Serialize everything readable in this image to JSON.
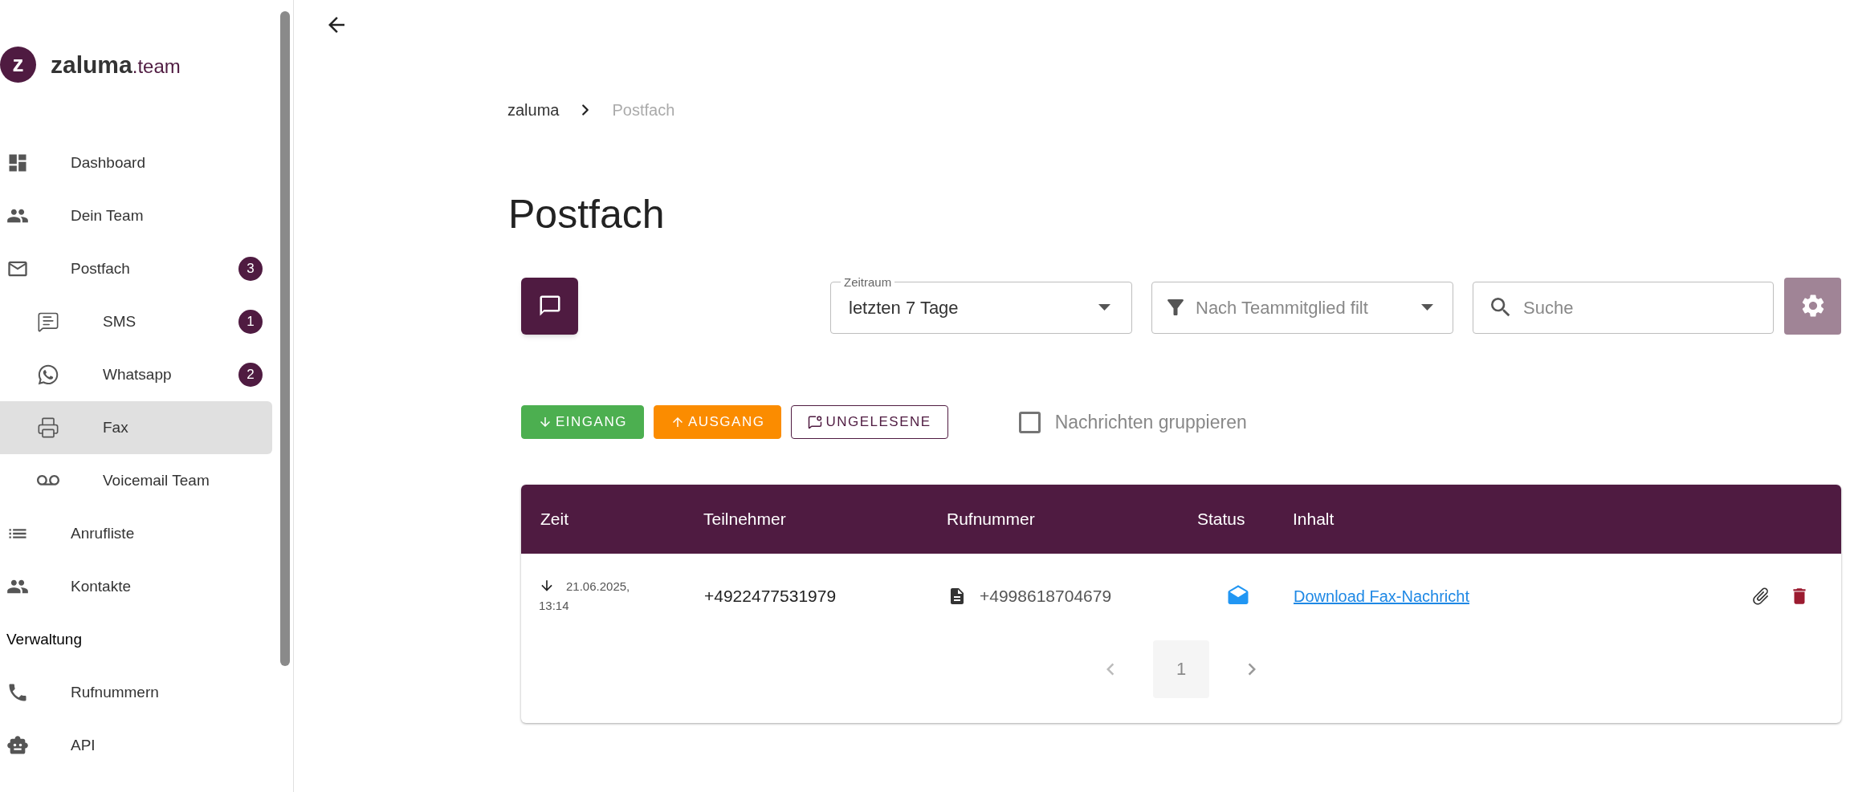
{
  "logo": {
    "mark": "z",
    "name": "zaluma",
    "suffix": ".team"
  },
  "sidebar": {
    "items": [
      {
        "label": "Dashboard",
        "selected": false
      },
      {
        "label": "Dein Team",
        "selected": false
      },
      {
        "label": "Postfach",
        "selected": false,
        "badge": "3",
        "children": [
          {
            "label": "SMS",
            "selected": false,
            "badge": "1"
          },
          {
            "label": "Whatsapp",
            "selected": false,
            "badge": "2"
          },
          {
            "label": "Fax",
            "selected": true
          },
          {
            "label": "Voicemail Team",
            "selected": false
          }
        ]
      },
      {
        "label": "Anrufliste",
        "selected": false
      },
      {
        "label": "Kontakte",
        "selected": false
      }
    ],
    "section": "Verwaltung",
    "section_items": [
      {
        "label": "Rufnummern",
        "selected": false
      },
      {
        "label": "API",
        "selected": false
      }
    ]
  },
  "breadcrumb": [
    "zaluma",
    "Postfach"
  ],
  "title": "Postfach",
  "filters": {
    "period": {
      "label": "Zeitraum",
      "value": "letzten 7 Tage"
    },
    "member": {
      "placeholder": "Nach Teammitglied filt"
    },
    "search": {
      "placeholder": "Suche"
    }
  },
  "direction_buttons": [
    {
      "label": "EINGANG",
      "selected": true,
      "color": "#4caf50"
    },
    {
      "label": "AUSGANG",
      "selected": true,
      "color": "#fb8c00"
    },
    {
      "label": "UNGELESENE",
      "selected": false,
      "color": "#4f1b41"
    }
  ],
  "group_checkbox": {
    "label": "Nachrichten gruppieren",
    "checked": false
  },
  "table": {
    "columns": [
      "Zeit",
      "Teilnehmer",
      "Rufnummer",
      "Status",
      "Inhalt"
    ],
    "rows": [
      {
        "time": "21.06.2025, 13:14",
        "participant": "+4922477531979",
        "number": "+4998618704679",
        "read": true,
        "content": "Download Fax-Nachricht"
      }
    ]
  },
  "pagination": [
    {
      "label": "1",
      "selected": true
    }
  ]
}
